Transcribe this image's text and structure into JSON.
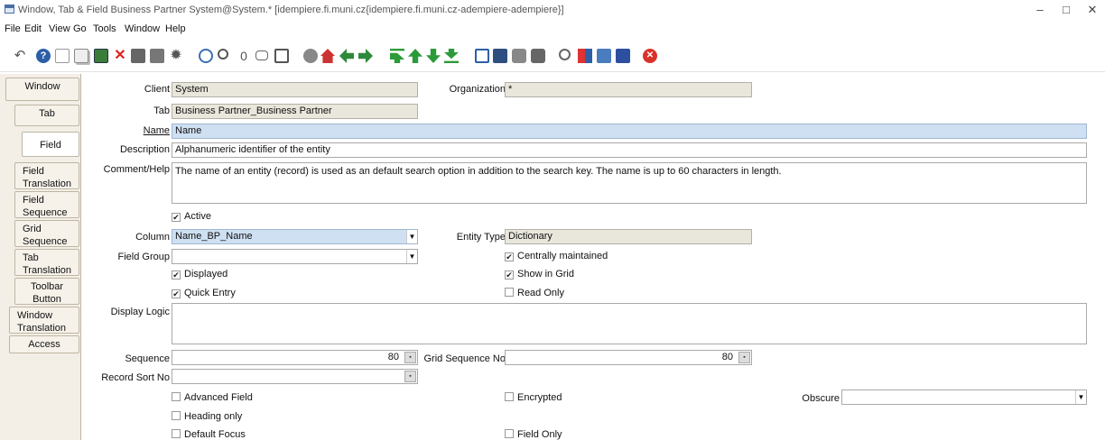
{
  "window": {
    "title": "Window, Tab & Field  Business Partner  System@System.* [idempiere.fi.muni.cz{idempiere.fi.muni.cz-adempiere-adempiere}]",
    "minimize": "–",
    "maximize": "□",
    "close": "✕"
  },
  "menu": {
    "file": "File",
    "edit": "Edit",
    "view": "View",
    "go": "Go",
    "tools": "Tools",
    "window": "Window",
    "help": "Help"
  },
  "toolbar_icons": [
    "undo-icon",
    "help-icon",
    "new-record-icon",
    "copy-record-icon",
    "save-icon",
    "delete-icon",
    "delete-selection-icon",
    "refresh-icon",
    "settings-icon",
    "requery-icon",
    "find-icon",
    "attachment-icon",
    "chat-icon",
    "grid-toggle-icon",
    "history-icon",
    "home-icon",
    "parent-record-icon",
    "detail-record-icon",
    "first-record-icon",
    "previous-record-icon",
    "next-record-icon",
    "last-record-icon",
    "report-icon",
    "archive-icon",
    "print-preview-icon",
    "print-icon",
    "zoom-across-icon",
    "active-workflows-icon",
    "product-info-icon",
    "end-icon",
    "exit-icon"
  ],
  "tabs": [
    {
      "label": "Window"
    },
    {
      "label": "Tab"
    },
    {
      "label": "Field"
    },
    {
      "label": "Field Translation"
    },
    {
      "label": "Field Sequence"
    },
    {
      "label": "Grid Sequence"
    },
    {
      "label": "Tab Translation"
    },
    {
      "label": "Toolbar Button"
    },
    {
      "label": "Window Translation"
    },
    {
      "label": "Access"
    }
  ],
  "form": {
    "client_label": "Client",
    "client_value": "System",
    "org_label": "Organization",
    "org_value": "*",
    "tab_label": "Tab",
    "tab_value": "Business Partner_Business Partner",
    "name_label": "Name",
    "name_value": "Name",
    "description_label": "Description",
    "description_value": "Alphanumeric identifier of the entity",
    "comment_label": "Comment/Help",
    "comment_value": "The name of an entity (record) is used as an default search option in addition to the search key. The name is up to 60 characters in length.",
    "active_label": "Active",
    "column_label": "Column",
    "column_value": "Name_BP_Name",
    "entity_type_label": "Entity Type",
    "entity_type_value": "Dictionary",
    "field_group_label": "Field Group",
    "field_group_value": "",
    "centrally_maintained_label": "Centrally maintained",
    "displayed_label": "Displayed",
    "show_in_grid_label": "Show in Grid",
    "quick_entry_label": "Quick Entry",
    "read_only_label": "Read Only",
    "display_logic_label": "Display Logic",
    "display_logic_value": "",
    "sequence_label": "Sequence",
    "sequence_value": "80",
    "grid_sequence_label": "Grid Sequence No",
    "grid_sequence_value": "80",
    "record_sort_label": "Record Sort No",
    "record_sort_value": "",
    "advanced_field_label": "Advanced Field",
    "encrypted_label": "Encrypted",
    "obscure_label": "Obscure",
    "obscure_value": "",
    "heading_only_label": "Heading only",
    "default_focus_label": "Default Focus",
    "field_only_label": "Field Only"
  },
  "checks": {
    "active": true,
    "centrally_maintained": true,
    "displayed": true,
    "show_in_grid": true,
    "quick_entry": true,
    "read_only": false,
    "advanced_field": false,
    "encrypted": false,
    "heading_only": false,
    "default_focus": false,
    "field_only": false
  },
  "colors": {
    "mandatory_field": "#cfe0f3",
    "readonly_field": "#e9e6dc",
    "tab_panel": "#f3efe6"
  }
}
